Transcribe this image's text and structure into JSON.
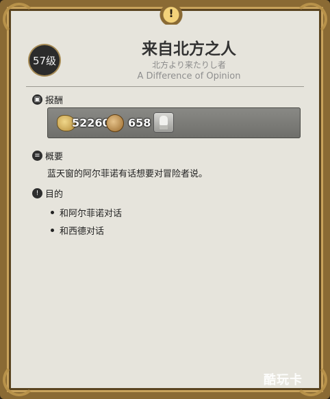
{
  "quest": {
    "level": "57级",
    "title": "来自北方之人",
    "subtitle_jp": "北方より来たりし者",
    "subtitle_en": "A Difference of Opinion"
  },
  "reward": {
    "heading": "报酬",
    "gil": "52260",
    "seals": "658"
  },
  "summary": {
    "heading": "概要",
    "text": "蓝天窗的阿尔菲诺有话想要对冒险者说。"
  },
  "objectives": {
    "heading": "目的",
    "items": [
      "和阿尔菲诺对话",
      "和西德对话"
    ]
  },
  "watermark": "酷玩卡",
  "icons": {
    "header": "exclamation-icon",
    "reward": "chest-icon",
    "summary": "book-icon",
    "objective": "exclamation-icon"
  },
  "colors": {
    "frame": "#8a6a34",
    "panel": "#e6e4dc",
    "badge": "#2b2b2b"
  }
}
